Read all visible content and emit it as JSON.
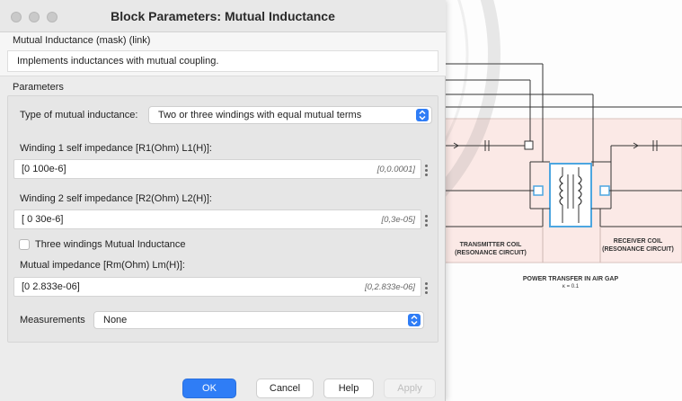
{
  "window": {
    "title": "Block Parameters: Mutual Inductance"
  },
  "mask": {
    "title": "Mutual Inductance (mask) (link)",
    "description": "Implements inductances with mutual coupling."
  },
  "parameters": {
    "section_title": "Parameters",
    "type": {
      "label": "Type of mutual inductance:",
      "value": "Two or three windings with equal mutual terms"
    },
    "winding1": {
      "label": "Winding 1 self impedance [R1(Ohm) L1(H)]:",
      "value": "[0 100e-6]",
      "range": "[0,0.0001]"
    },
    "winding2": {
      "label": "Winding 2 self impedance [R2(Ohm) L2(H)]:",
      "value": "[ 0 30e-6]",
      "range": "[0,3e-05]"
    },
    "three_windings": {
      "label": "Three windings Mutual Inductance",
      "checked": false
    },
    "mutual": {
      "label": "Mutual impedance [Rm(Ohm) Lm(H)]:",
      "value": "[0 2.833e-06]",
      "range": "[0,2.833e-06]"
    },
    "measurements": {
      "label": "Measurements",
      "value": "None"
    }
  },
  "buttons": {
    "ok": "OK",
    "cancel": "Cancel",
    "help": "Help",
    "apply": "Apply"
  },
  "diagram": {
    "transmitter_label_line1": "TRANSMITTER COIL",
    "transmitter_label_line2": "(RESONANCE CIRCUIT)",
    "receiver_label_line1": "RECEIVER COIL",
    "receiver_label_line2": "(RESONANCE CIRCUIT)",
    "caption": "POWER TRANSFER IN AIR GAP",
    "coupling": "κ = 0.1"
  },
  "colors": {
    "accent": "#2f7df6",
    "panel_bg": "#fbe9e6",
    "coil_box": "#4da6e0"
  }
}
